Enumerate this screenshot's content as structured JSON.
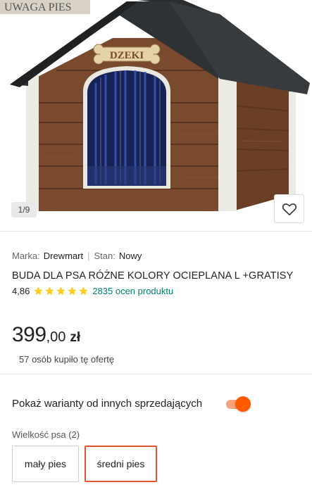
{
  "gallery": {
    "counter": "1/9",
    "sign_text": "UWAGA PIES",
    "nameplate_text": "DZEKI"
  },
  "product": {
    "brand_label": "Marka:",
    "brand": "Drewmart",
    "condition_label": "Stan:",
    "condition": "Nowy",
    "title": "BUDA DLA PSA RÓŻNE KOLORY OCIEPLANA L +GRATISY",
    "rating": "4,86",
    "stars": 5,
    "reviews": "2835 ocen produktu"
  },
  "price": {
    "main": "399",
    "fraction": ",00",
    "currency": "zł",
    "bought": "57 osób kupiło tę ofertę"
  },
  "variants_toggle": {
    "label": "Pokaż warianty od innych sprzedających",
    "on": true
  },
  "size": {
    "label": "Wielkość psa (2)",
    "options": [
      "mały pies",
      "średni pies"
    ],
    "selected": "średni pies"
  },
  "colors": {
    "accent": "#ff5a00",
    "selected_border": "#e0552c",
    "link": "#00806b",
    "star": "#ffca18"
  }
}
